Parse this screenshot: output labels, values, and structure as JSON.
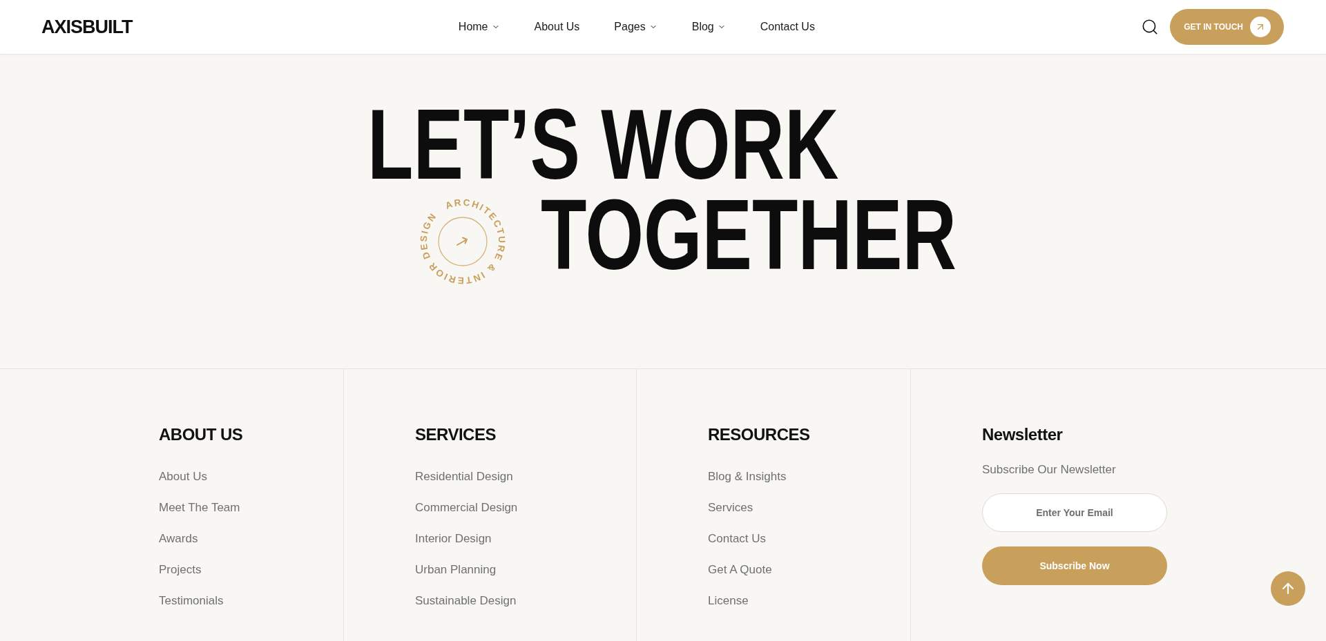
{
  "header": {
    "logo": "AXISBUILT",
    "nav": [
      {
        "label": "Home",
        "has_dropdown": true
      },
      {
        "label": "About Us",
        "has_dropdown": false
      },
      {
        "label": "Pages",
        "has_dropdown": true
      },
      {
        "label": "Blog",
        "has_dropdown": true
      },
      {
        "label": "Contact Us",
        "has_dropdown": false
      }
    ],
    "cta": {
      "label": "GET IN TOUCH"
    }
  },
  "hero": {
    "title_lines": [
      "LET’S WORK",
      "TOGETHER"
    ],
    "badge": {
      "circular_text": "ARCHITECTURE & INTERIOR DESIGN"
    }
  },
  "footer": {
    "columns": [
      {
        "heading": "ABOUT US",
        "links": [
          "About Us",
          "Meet The Team",
          "Awards",
          "Projects",
          "Testimonials"
        ]
      },
      {
        "heading": "SERVICES",
        "links": [
          "Residential Design",
          "Commercial Design",
          "Interior Design",
          "Urban Planning",
          "Sustainable Design"
        ]
      },
      {
        "heading": "RESOURCES",
        "links": [
          "Blog & Insights",
          "Services",
          "Contact Us",
          "Get A Quote",
          "License"
        ]
      }
    ],
    "newsletter": {
      "heading": "Newsletter",
      "text": "Subscribe Our Newsletter",
      "email_field": {
        "placeholder": "Enter Your Email"
      },
      "button": "Subscribe Now"
    }
  }
}
